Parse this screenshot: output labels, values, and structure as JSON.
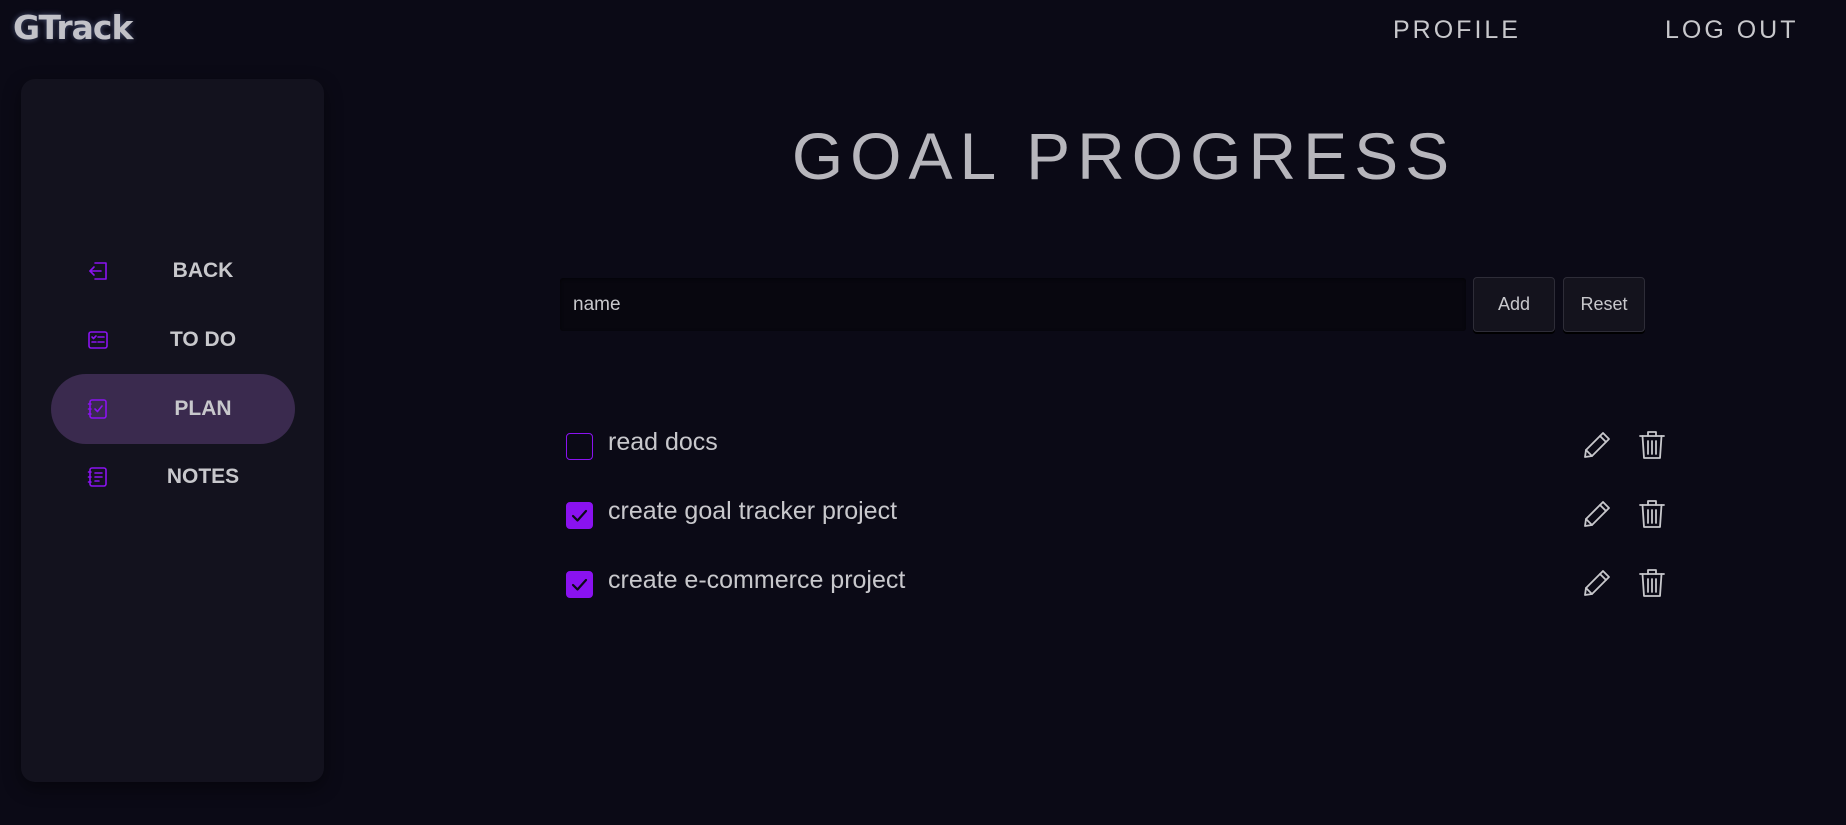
{
  "app": {
    "logo": "GTrack"
  },
  "header": {
    "profile_label": "PROFILE",
    "logout_label": "LOG OUT"
  },
  "sidebar": {
    "items": [
      {
        "label": "BACK",
        "icon": "back-arrow-icon",
        "active": false
      },
      {
        "label": "TO DO",
        "icon": "list-card-icon",
        "active": false
      },
      {
        "label": "PLAN",
        "icon": "checklist-icon",
        "active": true
      },
      {
        "label": "NOTES",
        "icon": "notes-icon",
        "active": false
      }
    ]
  },
  "main": {
    "title": "GOAL PROGRESS",
    "input": {
      "placeholder": "name",
      "value": ""
    },
    "add_label": "Add",
    "reset_label": "Reset",
    "goals": [
      {
        "text": "read docs",
        "completed": false
      },
      {
        "text": "create goal tracker project",
        "completed": true
      },
      {
        "text": "create e-commerce project",
        "completed": true
      }
    ]
  },
  "colors": {
    "background": "#0b0a16",
    "sidebar": "#13121e",
    "active_nav": "#3a2a4e",
    "accent": "#8a12f0",
    "text": "#c8c8cc"
  }
}
